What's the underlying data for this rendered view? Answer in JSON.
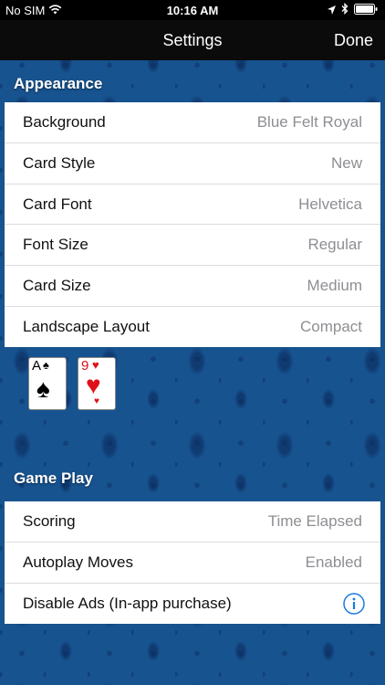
{
  "status": {
    "carrier": "No SIM",
    "time": "10:16 AM"
  },
  "nav": {
    "title": "Settings",
    "done_label": "Done"
  },
  "appearance": {
    "header": "Appearance",
    "rows": [
      {
        "label": "Background",
        "value": "Blue Felt Royal"
      },
      {
        "label": "Card Style",
        "value": "New"
      },
      {
        "label": "Card Font",
        "value": "Helvetica"
      },
      {
        "label": "Font Size",
        "value": "Regular"
      },
      {
        "label": "Card Size",
        "value": "Medium"
      },
      {
        "label": "Landscape Layout",
        "value": "Compact"
      }
    ]
  },
  "preview_cards": [
    {
      "rank": "A",
      "suit": "♠",
      "color": "#000000"
    },
    {
      "rank": "9",
      "suit": "♥",
      "color": "#e0101a"
    }
  ],
  "game_play": {
    "header": "Game Play",
    "rows": [
      {
        "label": "Scoring",
        "value": "Time Elapsed"
      },
      {
        "label": "Autoplay Moves",
        "value": "Enabled"
      },
      {
        "label": "Disable Ads (In-app purchase)",
        "value": ""
      }
    ]
  },
  "icons": {
    "wifi": "wifi-icon",
    "location": "location-arrow-icon",
    "bluetooth": "bluetooth-icon",
    "battery": "battery-icon",
    "info": "info-icon"
  },
  "colors": {
    "background": "#17538f",
    "accent": "#1a7ae0",
    "value_text": "#8e8e93"
  }
}
